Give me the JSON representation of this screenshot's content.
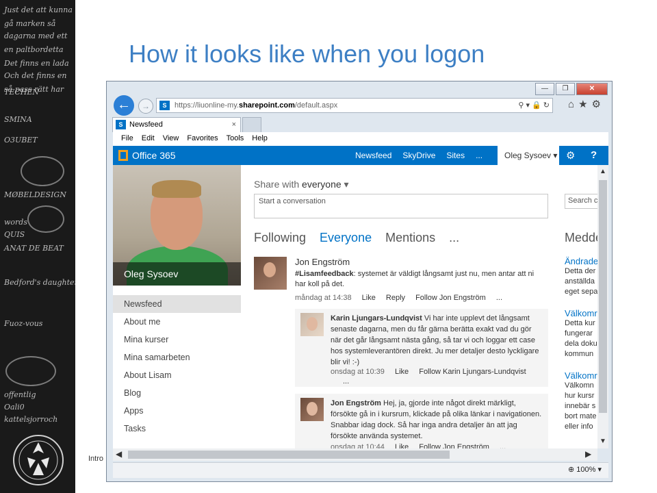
{
  "slide": {
    "title": "How it looks like when you logon",
    "footer_text": "Intro"
  },
  "chalkboard": {
    "lines": [
      "Just det att kunna",
      "gå marken så",
      "dagarna med ett",
      "en paltbordetta",
      "Det finns en lada",
      "Och det finns en",
      "så pass rätt har",
      "TECHEN",
      "SMINA",
      "O3UBET",
      "MØBELDESIGN",
      "words",
      "QUIS",
      "ANAT DE BEAT",
      "Bedford's daughter",
      "Fuoz-vous",
      "kattelsjorroch",
      "offentlig",
      "Oali0"
    ]
  },
  "browser": {
    "url_prefix": "https://liuonline-my.",
    "url_domain": "sharepoint.com",
    "url_suffix": "/default.aspx",
    "tab_label": "Newsfeed",
    "tab_close": "×",
    "menu": [
      "File",
      "Edit",
      "View",
      "Favorites",
      "Tools",
      "Help"
    ],
    "zoom": "100%",
    "win_minimize": "—",
    "win_restore": "❐",
    "win_close": "✕"
  },
  "o365": {
    "brand": "Office 365",
    "nav": [
      "Newsfeed",
      "SkyDrive",
      "Sites",
      "..."
    ],
    "user": "Oleg Sysoev ▾"
  },
  "profile": {
    "name": "Oleg Sysoev"
  },
  "left_nav": [
    "Newsfeed",
    "About me",
    "Mina kurser",
    "Mina samarbeten",
    "About Lisam",
    "Blog",
    "Apps",
    "Tasks"
  ],
  "share": {
    "label_prefix": "Share with ",
    "label_target": "everyone",
    "placeholder": "Start a conversation"
  },
  "feed_tabs": [
    "Following",
    "Everyone",
    "Mentions",
    "..."
  ],
  "post": {
    "author": "Jon Engström",
    "hashtag": "#Lisamfeedback",
    "text": ": systemet är väldigt långsamt just nu, men antar att ni har koll på det.",
    "time": "måndag at 14:38",
    "like": "Like",
    "reply": "Reply",
    "follow": "Follow Jon Engström",
    "more": "..."
  },
  "replies": [
    {
      "author": "Karin Ljungars-Lundqvist",
      "text": " Vi har inte upplevt det långsamt senaste dagarna, men du får gärna berätta exakt vad du gör när det går långsamt nästa gång, så tar vi och loggar ett case hos systemleverantören direkt. Ju mer detaljer desto lyckligare blir vi! :-)",
      "time": "onsdag at 10:39",
      "like": "Like",
      "follow": "Follow Karin Ljungars-Lundqvist",
      "more": "..."
    },
    {
      "author": "Jon Engström",
      "text": " Hej, ja, gjorde inte något direkt märkligt, försökte gå in i kursrum, klickade på olika länkar i navigationen. Snabbar idag dock. Så har inga andra detaljer än att jag försökte använda systemet.",
      "time": "onsdag at 10:44",
      "like": "Like",
      "follow": "Follow Jon Engström",
      "more": "..."
    }
  ],
  "right_column": {
    "search_placeholder": "Search co",
    "title": "Medde",
    "items": [
      {
        "link": "Ändrade",
        "lines": [
          "Detta der",
          "anställda",
          "eget sepa"
        ]
      },
      {
        "link": "Välkomr",
        "lines": [
          "Detta kur",
          "fungerar",
          "dela doku",
          "kommun"
        ]
      },
      {
        "link": "Välkomr",
        "lines": [
          "Välkomn",
          "hur kursr",
          "innebär s",
          "bort mate",
          "eller info"
        ]
      }
    ]
  },
  "icons": {
    "back": "back-arrow-icon",
    "forward": "forward-arrow-icon",
    "sharepoint": "sharepoint-icon",
    "home": "home-icon",
    "favorites": "star-icon",
    "tools": "gear-icon"
  }
}
